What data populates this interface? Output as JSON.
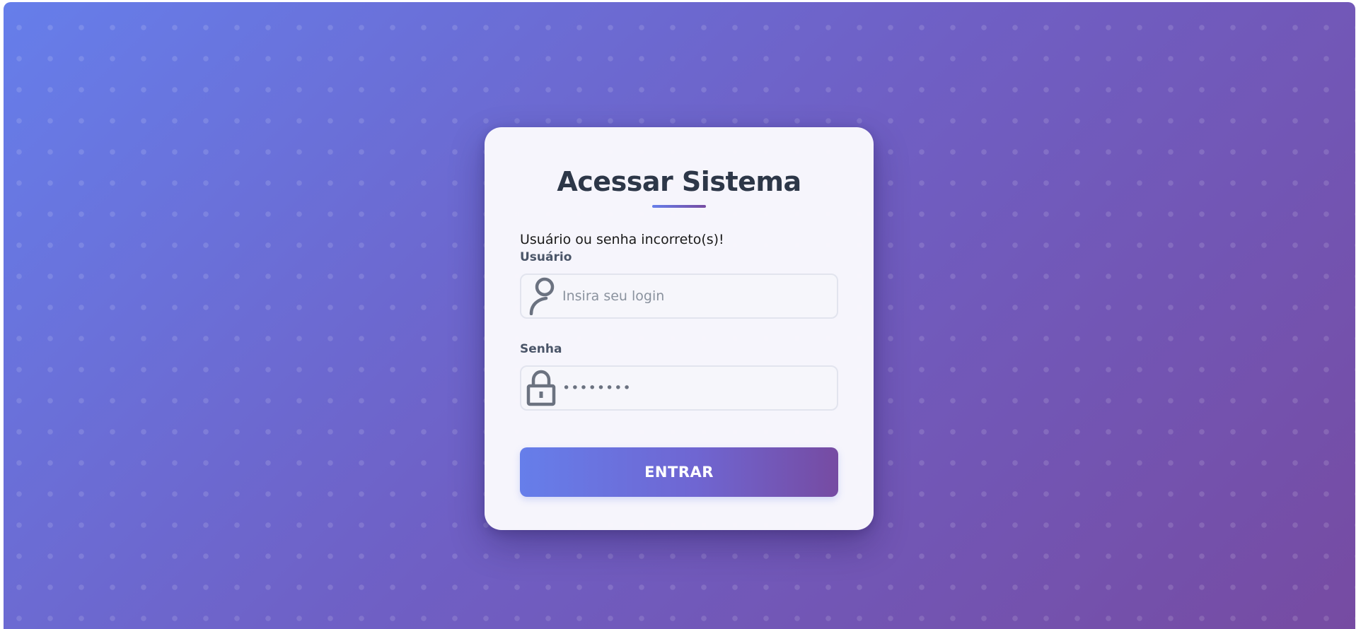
{
  "login": {
    "title": "Acessar Sistema",
    "error_message": "Usuário ou senha incorreto(s)!",
    "username": {
      "label": "Usuário",
      "placeholder": "Insira seu login",
      "value": "",
      "icon": "user-icon"
    },
    "password": {
      "label": "Senha",
      "value": "12345678",
      "icon": "lock-icon"
    },
    "submit_label": "ENTRAR"
  },
  "colors": {
    "gradient_start": "#667eea",
    "gradient_end": "#764ba2",
    "title_text": "#2d3748",
    "label_text": "#4a5568",
    "icon": "#6b7280"
  }
}
